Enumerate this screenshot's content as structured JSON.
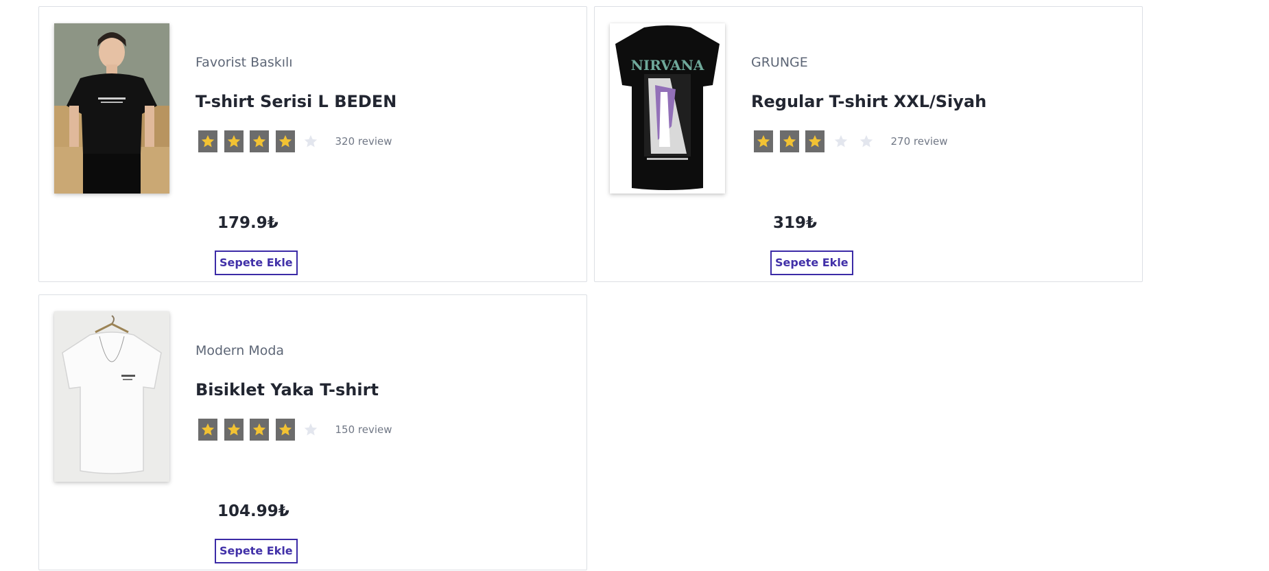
{
  "products": [
    {
      "brand": "Favorist Baskılı",
      "title": "T-shirt Serisi L BEDEN",
      "rating": 4,
      "max_rating": 5,
      "reviews": "320 review",
      "price": "179.9₺",
      "button_label": "Sepete Ekle",
      "image_icon": "model-black-tshirt-photo"
    },
    {
      "brand": "GRUNGE",
      "title": "Regular T-shirt XXL/Siyah",
      "rating": 3,
      "max_rating": 5,
      "reviews": "270 review",
      "price": "319₺",
      "button_label": "Sepete Ekle",
      "image_icon": "nirvana-print-tshirt-photo",
      "image_text": "NIRVANA"
    },
    {
      "brand": "Modern Moda",
      "title": "Bisiklet Yaka T-shirt",
      "rating": 4,
      "max_rating": 5,
      "reviews": "150 review",
      "price": "104.99₺",
      "button_label": "Sepete Ekle",
      "image_icon": "white-tshirt-hanger-photo"
    }
  ],
  "colors": {
    "star_filled": "#f2c233",
    "star_box": "#6c6c6c",
    "star_empty": "#e3e6ee",
    "button_border": "#3b2aa6",
    "button_text": "#4130a8"
  }
}
